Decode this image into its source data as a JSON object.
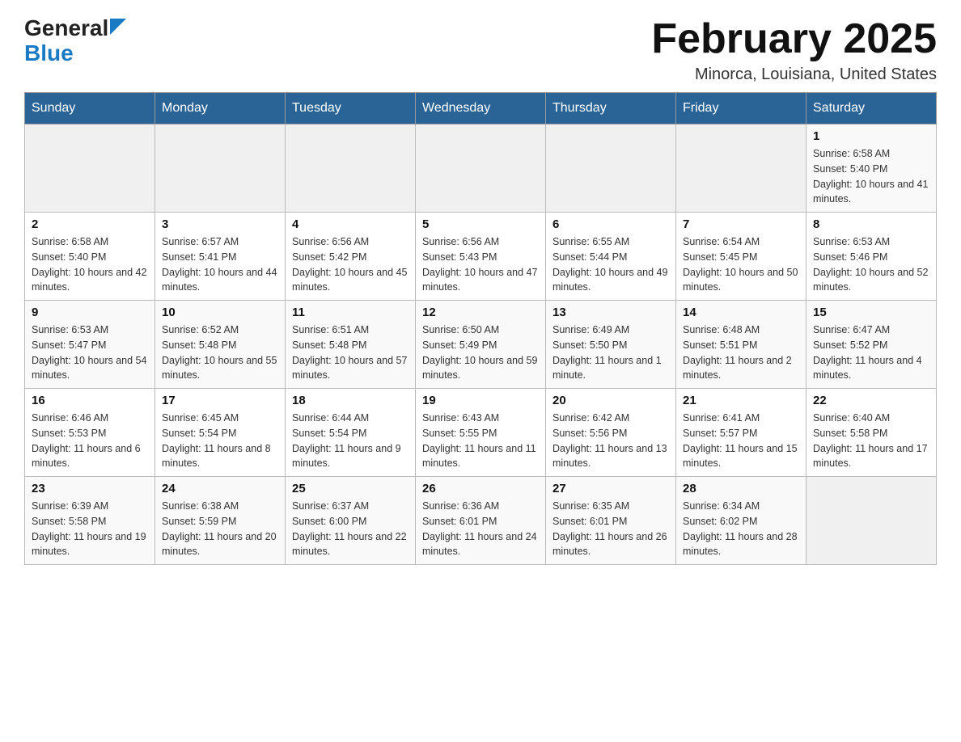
{
  "header": {
    "logo": {
      "general": "General",
      "blue": "Blue"
    },
    "title": "February 2025",
    "location": "Minorca, Louisiana, United States"
  },
  "calendar": {
    "days_of_week": [
      "Sunday",
      "Monday",
      "Tuesday",
      "Wednesday",
      "Thursday",
      "Friday",
      "Saturday"
    ],
    "weeks": [
      {
        "days": [
          {
            "date": "",
            "info": ""
          },
          {
            "date": "",
            "info": ""
          },
          {
            "date": "",
            "info": ""
          },
          {
            "date": "",
            "info": ""
          },
          {
            "date": "",
            "info": ""
          },
          {
            "date": "",
            "info": ""
          },
          {
            "date": "1",
            "info": "Sunrise: 6:58 AM\nSunset: 5:40 PM\nDaylight: 10 hours and 41 minutes."
          }
        ]
      },
      {
        "days": [
          {
            "date": "2",
            "info": "Sunrise: 6:58 AM\nSunset: 5:40 PM\nDaylight: 10 hours and 42 minutes."
          },
          {
            "date": "3",
            "info": "Sunrise: 6:57 AM\nSunset: 5:41 PM\nDaylight: 10 hours and 44 minutes."
          },
          {
            "date": "4",
            "info": "Sunrise: 6:56 AM\nSunset: 5:42 PM\nDaylight: 10 hours and 45 minutes."
          },
          {
            "date": "5",
            "info": "Sunrise: 6:56 AM\nSunset: 5:43 PM\nDaylight: 10 hours and 47 minutes."
          },
          {
            "date": "6",
            "info": "Sunrise: 6:55 AM\nSunset: 5:44 PM\nDaylight: 10 hours and 49 minutes."
          },
          {
            "date": "7",
            "info": "Sunrise: 6:54 AM\nSunset: 5:45 PM\nDaylight: 10 hours and 50 minutes."
          },
          {
            "date": "8",
            "info": "Sunrise: 6:53 AM\nSunset: 5:46 PM\nDaylight: 10 hours and 52 minutes."
          }
        ]
      },
      {
        "days": [
          {
            "date": "9",
            "info": "Sunrise: 6:53 AM\nSunset: 5:47 PM\nDaylight: 10 hours and 54 minutes."
          },
          {
            "date": "10",
            "info": "Sunrise: 6:52 AM\nSunset: 5:48 PM\nDaylight: 10 hours and 55 minutes."
          },
          {
            "date": "11",
            "info": "Sunrise: 6:51 AM\nSunset: 5:48 PM\nDaylight: 10 hours and 57 minutes."
          },
          {
            "date": "12",
            "info": "Sunrise: 6:50 AM\nSunset: 5:49 PM\nDaylight: 10 hours and 59 minutes."
          },
          {
            "date": "13",
            "info": "Sunrise: 6:49 AM\nSunset: 5:50 PM\nDaylight: 11 hours and 1 minute."
          },
          {
            "date": "14",
            "info": "Sunrise: 6:48 AM\nSunset: 5:51 PM\nDaylight: 11 hours and 2 minutes."
          },
          {
            "date": "15",
            "info": "Sunrise: 6:47 AM\nSunset: 5:52 PM\nDaylight: 11 hours and 4 minutes."
          }
        ]
      },
      {
        "days": [
          {
            "date": "16",
            "info": "Sunrise: 6:46 AM\nSunset: 5:53 PM\nDaylight: 11 hours and 6 minutes."
          },
          {
            "date": "17",
            "info": "Sunrise: 6:45 AM\nSunset: 5:54 PM\nDaylight: 11 hours and 8 minutes."
          },
          {
            "date": "18",
            "info": "Sunrise: 6:44 AM\nSunset: 5:54 PM\nDaylight: 11 hours and 9 minutes."
          },
          {
            "date": "19",
            "info": "Sunrise: 6:43 AM\nSunset: 5:55 PM\nDaylight: 11 hours and 11 minutes."
          },
          {
            "date": "20",
            "info": "Sunrise: 6:42 AM\nSunset: 5:56 PM\nDaylight: 11 hours and 13 minutes."
          },
          {
            "date": "21",
            "info": "Sunrise: 6:41 AM\nSunset: 5:57 PM\nDaylight: 11 hours and 15 minutes."
          },
          {
            "date": "22",
            "info": "Sunrise: 6:40 AM\nSunset: 5:58 PM\nDaylight: 11 hours and 17 minutes."
          }
        ]
      },
      {
        "days": [
          {
            "date": "23",
            "info": "Sunrise: 6:39 AM\nSunset: 5:58 PM\nDaylight: 11 hours and 19 minutes."
          },
          {
            "date": "24",
            "info": "Sunrise: 6:38 AM\nSunset: 5:59 PM\nDaylight: 11 hours and 20 minutes."
          },
          {
            "date": "25",
            "info": "Sunrise: 6:37 AM\nSunset: 6:00 PM\nDaylight: 11 hours and 22 minutes."
          },
          {
            "date": "26",
            "info": "Sunrise: 6:36 AM\nSunset: 6:01 PM\nDaylight: 11 hours and 24 minutes."
          },
          {
            "date": "27",
            "info": "Sunrise: 6:35 AM\nSunset: 6:01 PM\nDaylight: 11 hours and 26 minutes."
          },
          {
            "date": "28",
            "info": "Sunrise: 6:34 AM\nSunset: 6:02 PM\nDaylight: 11 hours and 28 minutes."
          },
          {
            "date": "",
            "info": ""
          }
        ]
      }
    ]
  }
}
